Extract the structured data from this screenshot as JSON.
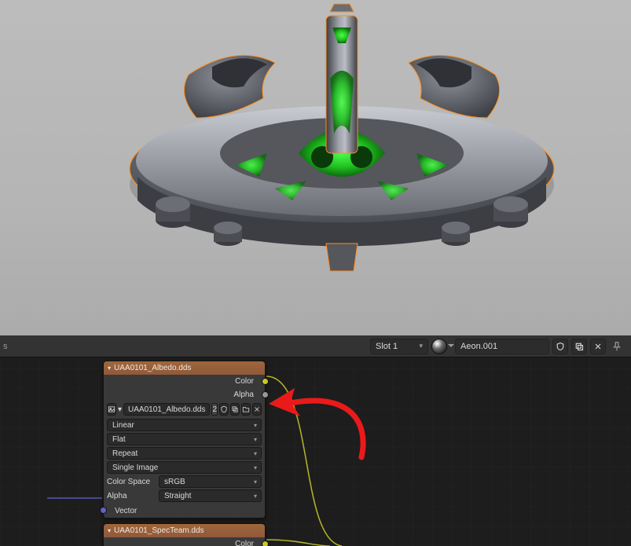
{
  "viewport": {
    "selection_outline_color": "#ff8c1a",
    "glow_color": "#26e026"
  },
  "header": {
    "slot_label": "Slot 1",
    "material_name": "Aeon.001"
  },
  "nodes": {
    "albedo": {
      "title": "UAA0101_Albedo.dds",
      "outputs": {
        "color": "Color",
        "alpha": "Alpha"
      },
      "image_name": "UAA0101_Albedo.dds",
      "users": "2",
      "interpolation": "Linear",
      "projection": "Flat",
      "extension": "Repeat",
      "source": "Single Image",
      "colorspace_label": "Color Space",
      "colorspace_value": "sRGB",
      "alpha_label": "Alpha",
      "alpha_value": "Straight",
      "input_vector": "Vector"
    },
    "specteam": {
      "title": "UAA0101_SpecTeam.dds",
      "outputs": {
        "color": "Color"
      }
    }
  },
  "icons": {
    "image_browse": "image-browse-icon",
    "shield": "fake-user-icon",
    "duplicate": "new-image-icon",
    "open": "open-image-icon",
    "unlink": "unlink-icon",
    "pin": "pin-icon"
  }
}
